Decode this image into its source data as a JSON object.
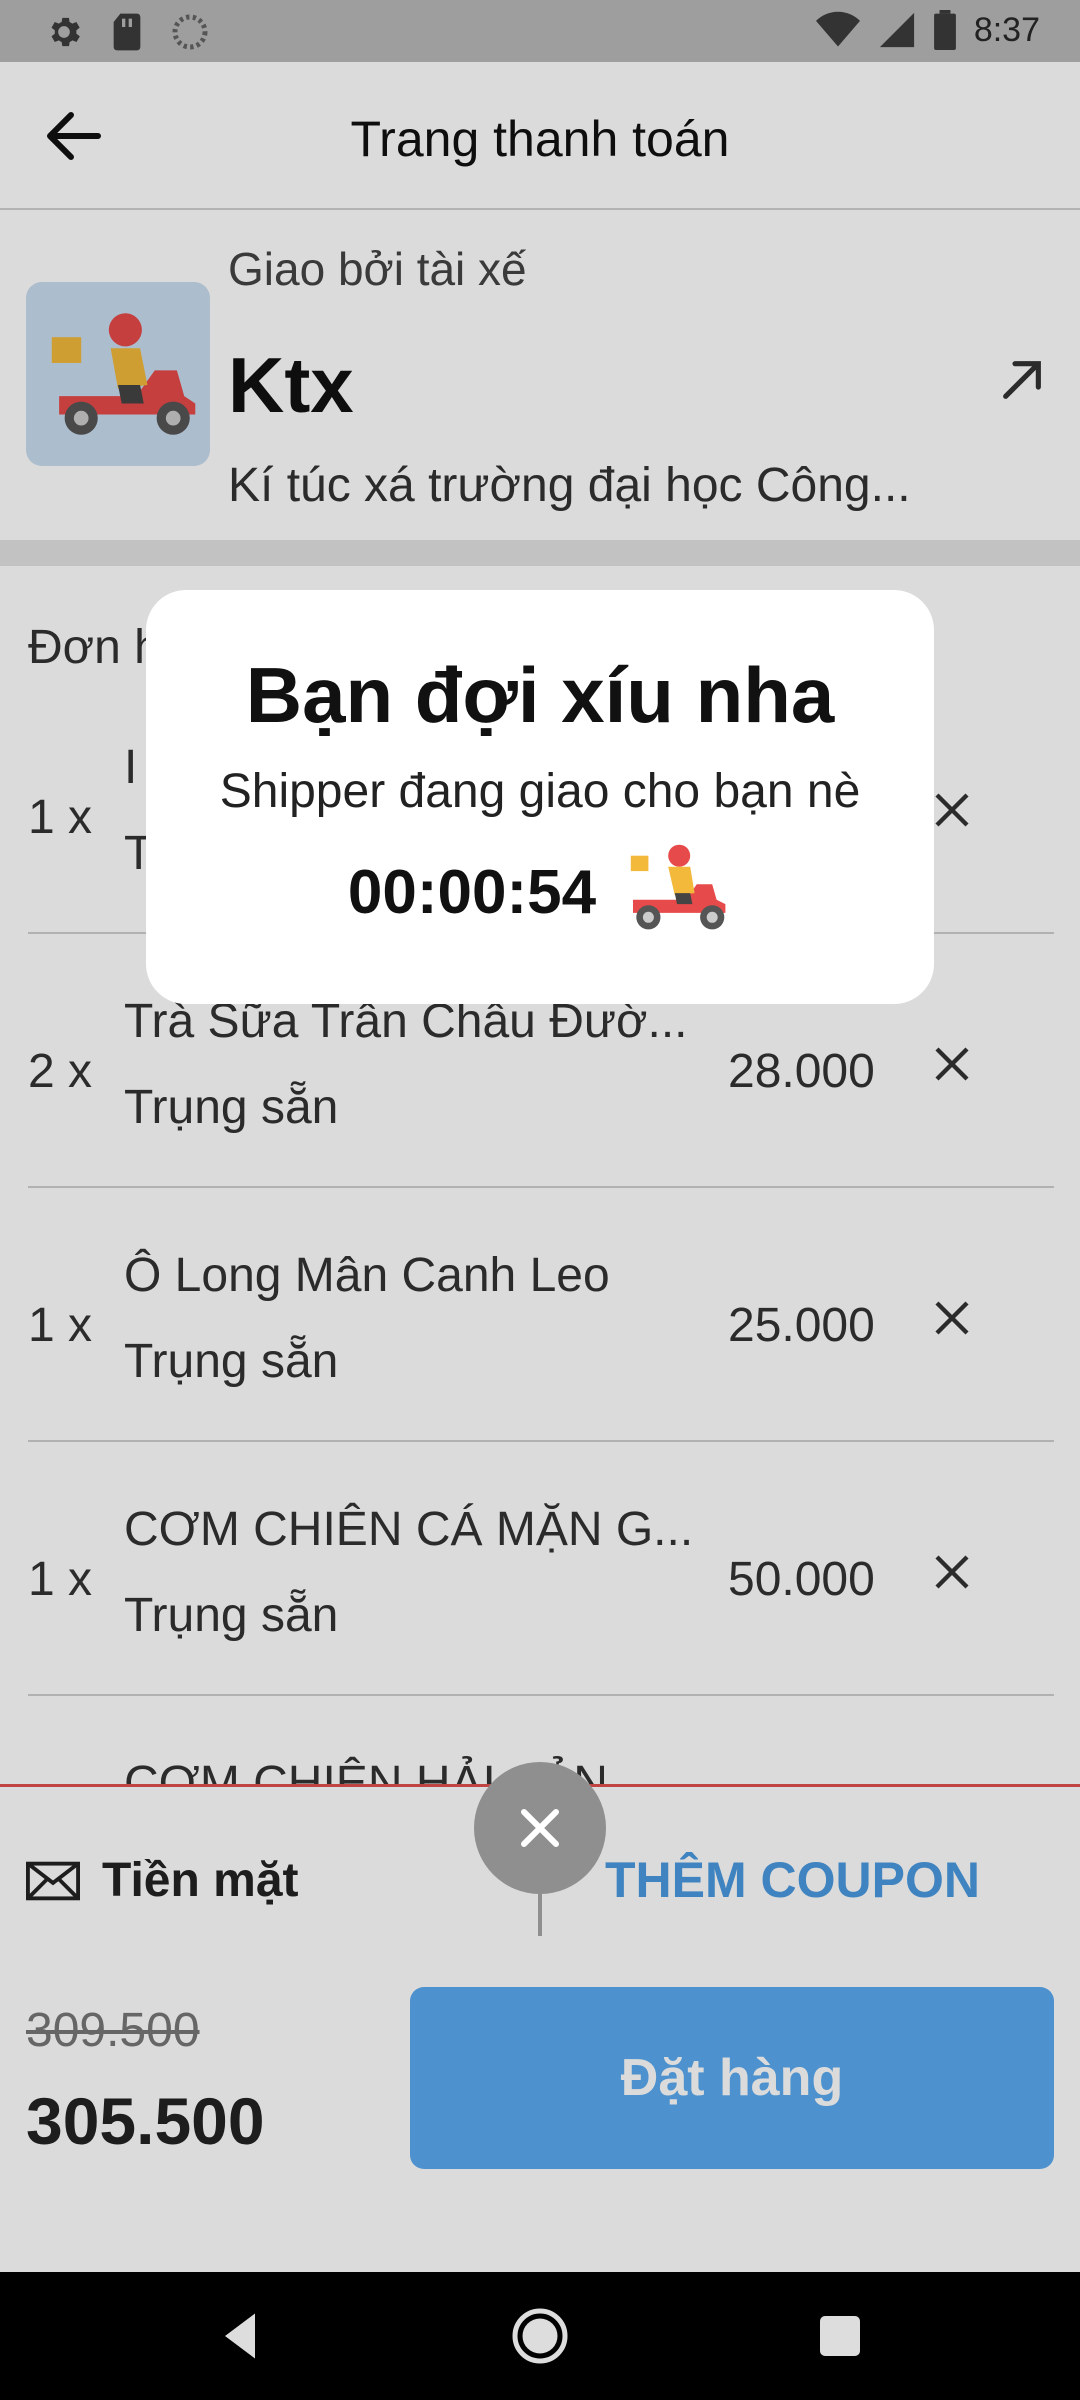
{
  "status_bar": {
    "time": "8:37"
  },
  "appbar": {
    "title": "Trang thanh toán"
  },
  "delivery": {
    "subtitle": "Giao bởi tài xế",
    "name": "Ktx",
    "address": "Kí túc xá trường đại học Công..."
  },
  "order": {
    "label": "Đơn h",
    "items": [
      {
        "qty": "1 x",
        "name": "I",
        "option": "T",
        "price": ""
      },
      {
        "qty": "2 x",
        "name": "Trà Sữa Trân Châu Đườ...",
        "option": "Trụng sẵn",
        "price": "28.000"
      },
      {
        "qty": "1 x",
        "name": "Ô Long Mân Canh Leo",
        "option": "Trụng sẵn",
        "price": "25.000"
      },
      {
        "qty": "1 x",
        "name": "CƠM CHIÊN CÁ MẶN G...",
        "option": "Trụng sẵn",
        "price": "50.000"
      },
      {
        "qty": "",
        "name": "CƠM CHIÊN HẢI SẢN",
        "option": "",
        "price": ""
      }
    ]
  },
  "payment": {
    "method": "Tiền mặt",
    "coupon_label": "THÊM COUPON",
    "old_total": "309.500",
    "total": "305.500",
    "order_button": "Đặt hàng"
  },
  "dialog": {
    "title": "Bạn đợi xíu nha",
    "message": "Shipper đang giao cho bạn nè",
    "timer": "00:00:54"
  },
  "colors": {
    "accent": "#4a9ae0",
    "order_button": "#5aaaf0",
    "divider_red": "#e05050"
  }
}
